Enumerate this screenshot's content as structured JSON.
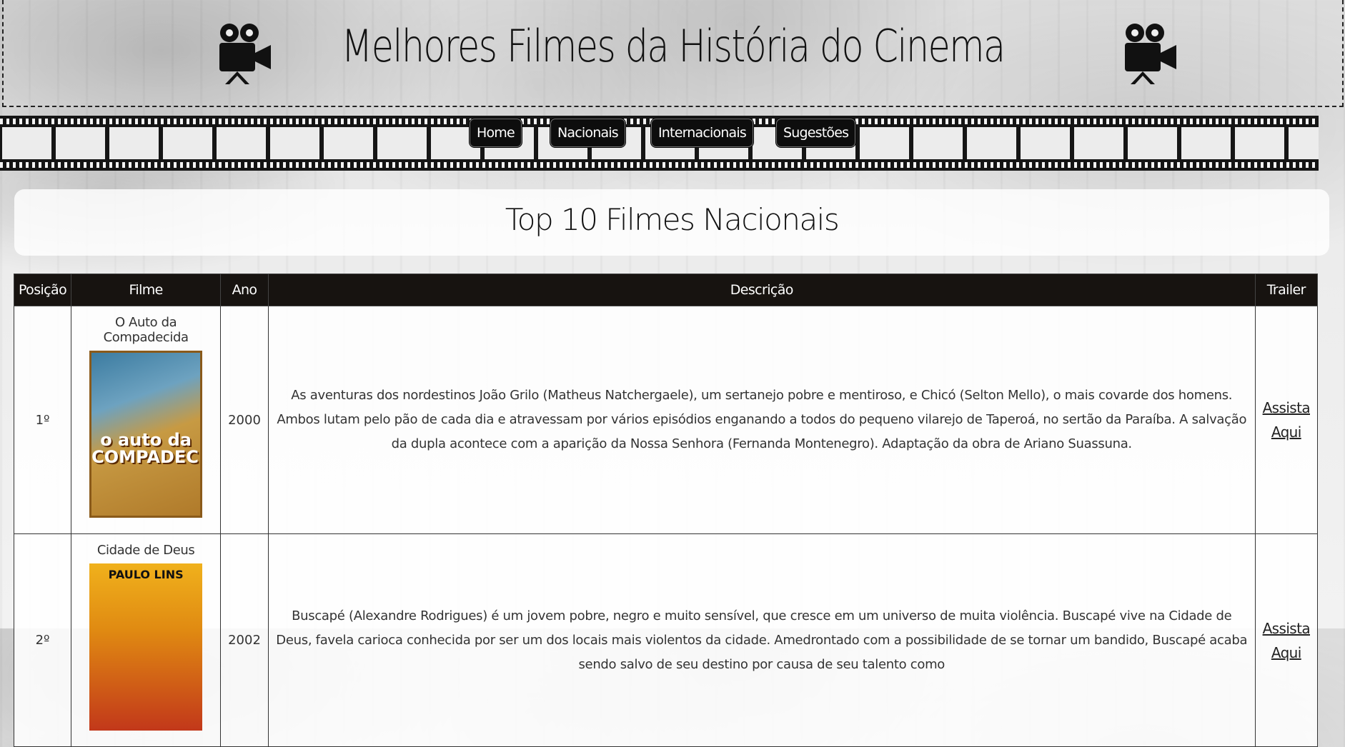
{
  "header": {
    "title": "Melhores Filmes da História do Cinema",
    "left_icon": "movie-camera-icon",
    "right_icon": "movie-camera-icon"
  },
  "nav": {
    "items": [
      {
        "label": "Home"
      },
      {
        "label": "Nacionais"
      },
      {
        "label": "Internacionais"
      },
      {
        "label": "Sugestões"
      }
    ]
  },
  "section": {
    "title": "Top 10 Filmes Nacionais"
  },
  "table": {
    "headers": [
      "Posição",
      "Filme",
      "Ano",
      "Descrição",
      "Trailer"
    ],
    "rows": [
      {
        "position": "1º",
        "film": "O Auto da Compadecida",
        "poster_text": "o auto da COMPADECIDA",
        "year": "2000",
        "description": "As aventuras dos nordestinos João Grilo (Matheus Natchergaele), um sertanejo pobre e mentiroso, e Chicó (Selton Mello), o mais covarde dos homens. Ambos lutam pelo pão de cada dia e atravessam por vários episódios enganando a todos do pequeno vilarejo de Taperoá, no sertão da Paraíba. A salvação da dupla acontece com a aparição da Nossa Senhora (Fernanda Montenegro). Adaptação da obra de Ariano Suassuna.",
        "trailer": "Assista Aqui"
      },
      {
        "position": "2º",
        "film": "Cidade de Deus",
        "poster_text": "PAULO LINS",
        "year": "2002",
        "description": "Buscapé (Alexandre Rodrigues) é um jovem pobre, negro e muito sensível, que cresce em um universo de muita violência. Buscapé vive na Cidade de Deus, favela carioca conhecida por ser um dos locais mais violentos da cidade. Amedrontado com a possibilidade de se tornar um bandido, Buscapé acaba sendo salvo de seu destino por causa de seu talento como",
        "trailer": "Assista Aqui"
      }
    ]
  }
}
